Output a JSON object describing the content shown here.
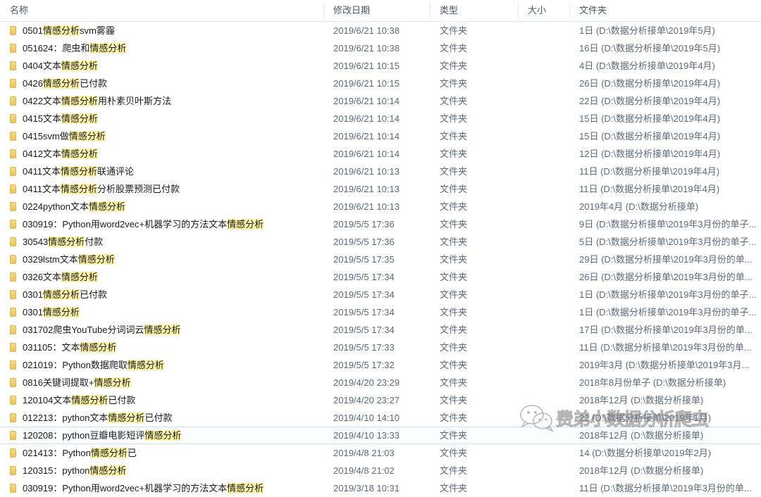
{
  "columns": {
    "name": "名称",
    "date": "修改日期",
    "type": "类型",
    "size": "大小",
    "folder": "文件夹"
  },
  "watermark": {
    "text": "费弟小数据分析爬虫",
    "icon": "wechat-icon"
  },
  "rows": [
    {
      "parts": [
        {
          "t": "0501",
          "h": false
        },
        {
          "t": "情感分析",
          "h": true
        },
        {
          "t": "svm雾霾",
          "h": false
        }
      ],
      "date": "2019/6/21 10:38",
      "type": "文件夹",
      "size": "",
      "folder": "1日 (D:\\数据分析接单\\2019年5月)",
      "selected": false
    },
    {
      "parts": [
        {
          "t": "051624：爬虫和",
          "h": false
        },
        {
          "t": "情感分析",
          "h": true
        }
      ],
      "date": "2019/6/21 10:38",
      "type": "文件夹",
      "size": "",
      "folder": "16日 (D:\\数据分析接单\\2019年5月)",
      "selected": false
    },
    {
      "parts": [
        {
          "t": "0404文本",
          "h": false
        },
        {
          "t": "情感分析",
          "h": true
        }
      ],
      "date": "2019/6/21 10:15",
      "type": "文件夹",
      "size": "",
      "folder": "4日 (D:\\数据分析接单\\2019年4月)",
      "selected": false
    },
    {
      "parts": [
        {
          "t": "0426",
          "h": false
        },
        {
          "t": "情感分析",
          "h": true
        },
        {
          "t": "已付款",
          "h": false
        }
      ],
      "date": "2019/6/21 10:15",
      "type": "文件夹",
      "size": "",
      "folder": "26日 (D:\\数据分析接单\\2019年4月)",
      "selected": false
    },
    {
      "parts": [
        {
          "t": "0422文本",
          "h": false
        },
        {
          "t": "情感分析",
          "h": true
        },
        {
          "t": "用朴素贝叶斯方法",
          "h": false
        }
      ],
      "date": "2019/6/21 10:14",
      "type": "文件夹",
      "size": "",
      "folder": "22日 (D:\\数据分析接单\\2019年4月)",
      "selected": false
    },
    {
      "parts": [
        {
          "t": "0415文本",
          "h": false
        },
        {
          "t": "情感分析",
          "h": true
        }
      ],
      "date": "2019/6/21 10:14",
      "type": "文件夹",
      "size": "",
      "folder": "15日 (D:\\数据分析接单\\2019年4月)",
      "selected": false
    },
    {
      "parts": [
        {
          "t": "0415svm做",
          "h": false
        },
        {
          "t": "情感分析",
          "h": true
        }
      ],
      "date": "2019/6/21 10:14",
      "type": "文件夹",
      "size": "",
      "folder": "15日 (D:\\数据分析接单\\2019年4月)",
      "selected": false
    },
    {
      "parts": [
        {
          "t": "0412文本",
          "h": false
        },
        {
          "t": "情感分析",
          "h": true
        }
      ],
      "date": "2019/6/21 10:14",
      "type": "文件夹",
      "size": "",
      "folder": "12日 (D:\\数据分析接单\\2019年4月)",
      "selected": false
    },
    {
      "parts": [
        {
          "t": "0411文本",
          "h": false
        },
        {
          "t": "情感分析",
          "h": true
        },
        {
          "t": "联通评论",
          "h": false
        }
      ],
      "date": "2019/6/21 10:13",
      "type": "文件夹",
      "size": "",
      "folder": "11日 (D:\\数据分析接单\\2019年4月)",
      "selected": false
    },
    {
      "parts": [
        {
          "t": "0411文本",
          "h": false
        },
        {
          "t": "情感分析",
          "h": true
        },
        {
          "t": "分析股票预测已付款",
          "h": false
        }
      ],
      "date": "2019/6/21 10:13",
      "type": "文件夹",
      "size": "",
      "folder": "11日 (D:\\数据分析接单\\2019年4月)",
      "selected": false
    },
    {
      "parts": [
        {
          "t": "0224python文本",
          "h": false
        },
        {
          "t": "情感分析",
          "h": true
        }
      ],
      "date": "2019/6/21 10:13",
      "type": "文件夹",
      "size": "",
      "folder": "2019年4月 (D:\\数据分析接单)",
      "selected": false
    },
    {
      "parts": [
        {
          "t": "030919：Python用word2vec+机器学习的方法文本",
          "h": false
        },
        {
          "t": "情感分析",
          "h": true
        }
      ],
      "date": "2019/5/5 17:36",
      "type": "文件夹",
      "size": "",
      "folder": "9日 (D:\\数据分析接单\\2019年3月份的单子...",
      "selected": false
    },
    {
      "parts": [
        {
          "t": "30543",
          "h": false
        },
        {
          "t": "情感分析",
          "h": true
        },
        {
          "t": "付款",
          "h": false
        }
      ],
      "date": "2019/5/5 17:36",
      "type": "文件夹",
      "size": "",
      "folder": "5日 (D:\\数据分析接单\\2019年3月份的单子...",
      "selected": false
    },
    {
      "parts": [
        {
          "t": "0329lstm文本",
          "h": false
        },
        {
          "t": "情感分析",
          "h": true
        }
      ],
      "date": "2019/5/5 17:35",
      "type": "文件夹",
      "size": "",
      "folder": "29日 (D:\\数据分析接单\\2019年3月份的单...",
      "selected": false
    },
    {
      "parts": [
        {
          "t": "0326文本",
          "h": false
        },
        {
          "t": "情感分析",
          "h": true
        }
      ],
      "date": "2019/5/5 17:34",
      "type": "文件夹",
      "size": "",
      "folder": "26日 (D:\\数据分析接单\\2019年3月份的单...",
      "selected": false
    },
    {
      "parts": [
        {
          "t": "0301",
          "h": false
        },
        {
          "t": "情感分析",
          "h": true
        },
        {
          "t": "已付款",
          "h": false
        }
      ],
      "date": "2019/5/5 17:34",
      "type": "文件夹",
      "size": "",
      "folder": "1日 (D:\\数据分析接单\\2019年3月份的单子...",
      "selected": false
    },
    {
      "parts": [
        {
          "t": "0301",
          "h": false
        },
        {
          "t": "情感分析",
          "h": true
        }
      ],
      "date": "2019/5/5 17:34",
      "type": "文件夹",
      "size": "",
      "folder": "1日 (D:\\数据分析接单\\2019年3月份的单子...",
      "selected": false
    },
    {
      "parts": [
        {
          "t": "031702爬虫YouTube分词词云",
          "h": false
        },
        {
          "t": "情感分析",
          "h": true
        }
      ],
      "date": "2019/5/5 17:34",
      "type": "文件夹",
      "size": "",
      "folder": "17日 (D:\\数据分析接单\\2019年3月份的单...",
      "selected": false
    },
    {
      "parts": [
        {
          "t": "031105：文本",
          "h": false
        },
        {
          "t": "情感分析",
          "h": true
        }
      ],
      "date": "2019/5/5 17:33",
      "type": "文件夹",
      "size": "",
      "folder": "11日 (D:\\数据分析接单\\2019年3月份的单...",
      "selected": false
    },
    {
      "parts": [
        {
          "t": "021019：Python数据爬取",
          "h": false
        },
        {
          "t": "情感分析",
          "h": true
        }
      ],
      "date": "2019/5/5 17:32",
      "type": "文件夹",
      "size": "",
      "folder": "2019年3月 (D:\\数据分析接单\\2019年3月...",
      "selected": false
    },
    {
      "parts": [
        {
          "t": "0816关键词提取+",
          "h": false
        },
        {
          "t": "情感分析",
          "h": true
        }
      ],
      "date": "2019/4/20 23:29",
      "type": "文件夹",
      "size": "",
      "folder": "2018年8月份单子 (D:\\数据分析接单)",
      "selected": false
    },
    {
      "parts": [
        {
          "t": "120104文本",
          "h": false
        },
        {
          "t": "情感分析",
          "h": true
        },
        {
          "t": "已付款",
          "h": false
        }
      ],
      "date": "2019/4/20 23:27",
      "type": "文件夹",
      "size": "",
      "folder": "2018年12月 (D:\\数据分析接单)",
      "selected": false
    },
    {
      "parts": [
        {
          "t": "012213：python文本",
          "h": false
        },
        {
          "t": "情感分析",
          "h": true
        },
        {
          "t": "已付款",
          "h": false
        }
      ],
      "date": "2019/4/10 14:10",
      "type": "文件夹",
      "size": "",
      "folder": "22 (D:\\数据分析接单\\2019年1月)",
      "selected": false
    },
    {
      "parts": [
        {
          "t": "120208：python豆瓣电影短评",
          "h": false
        },
        {
          "t": "情感分析",
          "h": true
        }
      ],
      "date": "2019/4/10 13:33",
      "type": "文件夹",
      "size": "",
      "folder": "2018年12月 (D:\\数据分析接单)",
      "selected": true
    },
    {
      "parts": [
        {
          "t": "021413：Python",
          "h": false
        },
        {
          "t": "情感分析",
          "h": true
        },
        {
          "t": "已",
          "h": false
        }
      ],
      "date": "2019/4/8 21:03",
      "type": "文件夹",
      "size": "",
      "folder": "14 (D:\\数据分析接单\\2019年2月)",
      "selected": false
    },
    {
      "parts": [
        {
          "t": "120315：python",
          "h": false
        },
        {
          "t": "情感分析",
          "h": true
        }
      ],
      "date": "2019/4/8 21:02",
      "type": "文件夹",
      "size": "",
      "folder": "2018年12月 (D:\\数据分析接单)",
      "selected": false
    },
    {
      "parts": [
        {
          "t": "030919：Python用word2vec+机器学习的方法文本",
          "h": false
        },
        {
          "t": "情感分析",
          "h": true
        }
      ],
      "date": "2019/3/18 10:31",
      "type": "文件夹",
      "size": "",
      "folder": "11日 (D:\\数据分析接单\\2019年3月份的单...",
      "selected": false
    }
  ]
}
